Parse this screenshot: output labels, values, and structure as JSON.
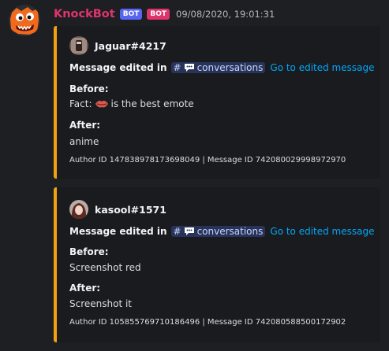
{
  "message": {
    "author": "KnockBot",
    "bot_tags": [
      "BOT",
      "BOT"
    ],
    "bot_tag_colors": [
      "#5865f2",
      "#e0336c"
    ],
    "timestamp": "09/08/2020, 19:01:31",
    "avatar_icon": "orange-monster-avatar"
  },
  "embeds": [
    {
      "accent_color": "#f0a212",
      "author_name": "Jaguar#4217",
      "author_avatar_icon": "drink-photo-avatar",
      "title_prefix": "Message edited in",
      "channel_hash": "#",
      "channel_icon": "chat-bubble-icon",
      "channel_name": "conversations",
      "link_text": "Go to edited message",
      "before_label": "Before:",
      "before_value_prefix": "Fact:",
      "before_value_suffix": "is the best emote",
      "before_emote_icon": "lips-emote-icon",
      "after_label": "After:",
      "after_value": "anime",
      "footer": "Author ID 147838978173698049 | Message ID 742080029998972970"
    },
    {
      "accent_color": "#f0a212",
      "author_name": "kasool#1571",
      "author_avatar_icon": "anime-girl-avatar",
      "title_prefix": "Message edited in",
      "channel_hash": "#",
      "channel_icon": "chat-bubble-icon",
      "channel_name": "conversations",
      "link_text": "Go to edited message",
      "before_label": "Before:",
      "before_value": "Screenshot red",
      "after_label": "After:",
      "after_value": "Screenshot it",
      "footer": "Author ID 105855769710186496 | Message ID 742080588500172902"
    }
  ]
}
